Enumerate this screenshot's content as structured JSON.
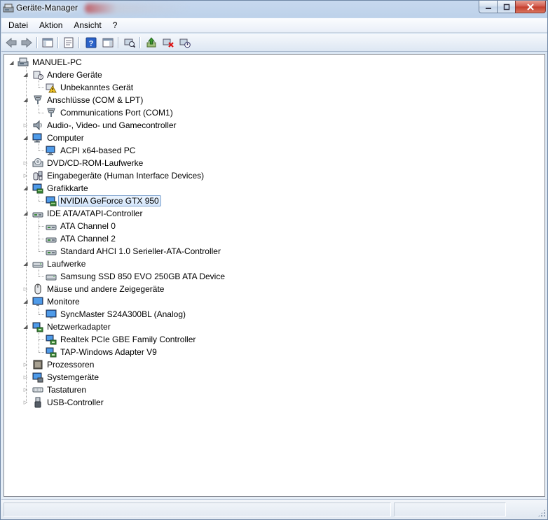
{
  "window": {
    "title": "Geräte-Manager"
  },
  "menubar": {
    "items": [
      "Datei",
      "Aktion",
      "Ansicht",
      "?"
    ]
  },
  "toolbar": {
    "buttons": [
      {
        "name": "back-icon"
      },
      {
        "name": "forward-icon"
      },
      {
        "name": "show-hide-console-tree-icon"
      },
      {
        "name": "properties-icon"
      },
      {
        "name": "help-icon"
      },
      {
        "name": "show-action-pane-icon"
      },
      {
        "name": "scan-hardware-icon"
      },
      {
        "name": "update-driver-icon"
      },
      {
        "name": "uninstall-device-icon"
      },
      {
        "name": "disable-device-icon"
      }
    ]
  },
  "tree": {
    "root": "MANUEL-PC",
    "rows": [
      {
        "label": "Andere Geräte",
        "level": 1,
        "expanded": true,
        "icon": "other-devices-icon"
      },
      {
        "label": "Unbekanntes Gerät",
        "level": 2,
        "icon": "unknown-device-warning-icon"
      },
      {
        "label": "Anschlüsse (COM & LPT)",
        "level": 1,
        "expanded": true,
        "icon": "ports-icon"
      },
      {
        "label": "Communications Port (COM1)",
        "level": 2,
        "icon": "port-icon"
      },
      {
        "label": "Audio-, Video- und Gamecontroller",
        "level": 1,
        "expanded": false,
        "icon": "speaker-icon"
      },
      {
        "label": "Computer",
        "level": 1,
        "expanded": true,
        "icon": "computer-icon"
      },
      {
        "label": "ACPI x64-based PC",
        "level": 2,
        "icon": "computer-icon"
      },
      {
        "label": "DVD/CD-ROM-Laufwerke",
        "level": 1,
        "expanded": false,
        "icon": "dvd-drive-icon"
      },
      {
        "label": "Eingabegeräte (Human Interface Devices)",
        "level": 1,
        "expanded": false,
        "icon": "hid-icon"
      },
      {
        "label": "Grafikkarte",
        "level": 1,
        "expanded": true,
        "icon": "display-adapter-icon"
      },
      {
        "label": "NVIDIA GeForce GTX 950",
        "level": 2,
        "icon": "display-adapter-icon",
        "selected": true
      },
      {
        "label": "IDE ATA/ATAPI-Controller",
        "level": 1,
        "expanded": true,
        "icon": "ide-controller-icon"
      },
      {
        "label": "ATA Channel 0",
        "level": 2,
        "icon": "ide-controller-icon"
      },
      {
        "label": "ATA Channel 2",
        "level": 2,
        "icon": "ide-controller-icon"
      },
      {
        "label": "Standard AHCI 1.0 Serieller-ATA-Controller",
        "level": 2,
        "icon": "ide-controller-icon"
      },
      {
        "label": "Laufwerke",
        "level": 1,
        "expanded": true,
        "icon": "disk-drive-icon"
      },
      {
        "label": "Samsung SSD 850 EVO 250GB ATA Device",
        "level": 2,
        "icon": "disk-drive-icon"
      },
      {
        "label": "Mäuse und andere Zeigegeräte",
        "level": 1,
        "expanded": false,
        "icon": "mouse-icon"
      },
      {
        "label": "Monitore",
        "level": 1,
        "expanded": true,
        "icon": "monitor-icon"
      },
      {
        "label": "SyncMaster S24A300BL (Analog)",
        "level": 2,
        "icon": "monitor-icon"
      },
      {
        "label": "Netzwerkadapter",
        "level": 1,
        "expanded": true,
        "icon": "network-adapter-icon"
      },
      {
        "label": "Realtek PCIe GBE Family Controller",
        "level": 2,
        "icon": "network-adapter-icon"
      },
      {
        "label": "TAP-Windows Adapter V9",
        "level": 2,
        "icon": "network-adapter-icon"
      },
      {
        "label": "Prozessoren",
        "level": 1,
        "expanded": false,
        "icon": "processor-icon"
      },
      {
        "label": "Systemgeräte",
        "level": 1,
        "expanded": false,
        "icon": "system-devices-icon"
      },
      {
        "label": "Tastaturen",
        "level": 1,
        "expanded": false,
        "icon": "keyboard-icon"
      },
      {
        "label": "USB-Controller",
        "level": 1,
        "expanded": false,
        "icon": "usb-icon"
      }
    ]
  },
  "colors": {
    "selection_border": "#7da2ce",
    "selection_fill": "#d4e6fb",
    "close_button": "#c43c2b"
  }
}
